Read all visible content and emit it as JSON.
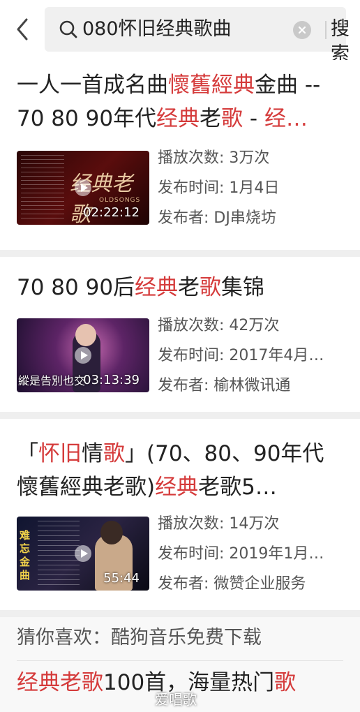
{
  "search": {
    "query": "080怀旧经典歌曲",
    "button_label": "搜索"
  },
  "results": [
    {
      "title_parts": [
        {
          "text": "一人一首成名曲",
          "hl": false
        },
        {
          "text": "懷舊經典",
          "hl": true
        },
        {
          "text": "金曲 -- 70 80 90年代",
          "hl": false
        },
        {
          "text": "经典",
          "hl": true
        },
        {
          "text": "老",
          "hl": false
        },
        {
          "text": "歌",
          "hl": true
        },
        {
          "text": " - ",
          "hl": false
        },
        {
          "text": "经…",
          "hl": true
        }
      ],
      "thumbnail_caption": "经典老歌",
      "thumbnail_subcaption": "OLDSONGS",
      "duration": "02:22:12",
      "plays": "播放次数: 3万次",
      "published": "发布时间: 1月4日",
      "publisher": "发布者: DJ串烧坊"
    },
    {
      "title_parts": [
        {
          "text": "70 80 90后",
          "hl": false
        },
        {
          "text": "经典",
          "hl": true
        },
        {
          "text": "老",
          "hl": false
        },
        {
          "text": "歌",
          "hl": true
        },
        {
          "text": "集锦",
          "hl": false
        }
      ],
      "thumbnail_caption": "縱是告別也交",
      "duration": "03:13:39",
      "plays": "播放次数: 42万次",
      "published": "发布时间: 2017年4月…",
      "publisher": "发布者: 榆林微讯通"
    },
    {
      "title_parts": [
        {
          "text": "「",
          "hl": false
        },
        {
          "text": "怀旧",
          "hl": true
        },
        {
          "text": "情",
          "hl": false
        },
        {
          "text": "歌",
          "hl": true
        },
        {
          "text": "」(70、80、90年代 懷舊經典老歌)",
          "hl": false
        },
        {
          "text": "经典",
          "hl": true
        },
        {
          "text": "老歌5…",
          "hl": false
        }
      ],
      "thumbnail_caption": "难忘金曲",
      "duration": "55:44",
      "plays": "播放次数: 14万次",
      "published": "发布时间: 2019年1月…",
      "publisher": "发布者: 微赞企业服务"
    }
  ],
  "suggestions": {
    "label": "猜你喜欢：酷狗音乐免费下载",
    "first_item_parts": [
      {
        "text": "经典老歌",
        "hl": true
      },
      {
        "text": "100首，海量热门",
        "hl": false
      },
      {
        "text": "歌",
        "hl": true
      }
    ]
  },
  "watermark": "爱唱歌",
  "colors": {
    "highlight": "#d53b3b",
    "divider": "#efefef",
    "search_bg": "#f0f0f0"
  }
}
